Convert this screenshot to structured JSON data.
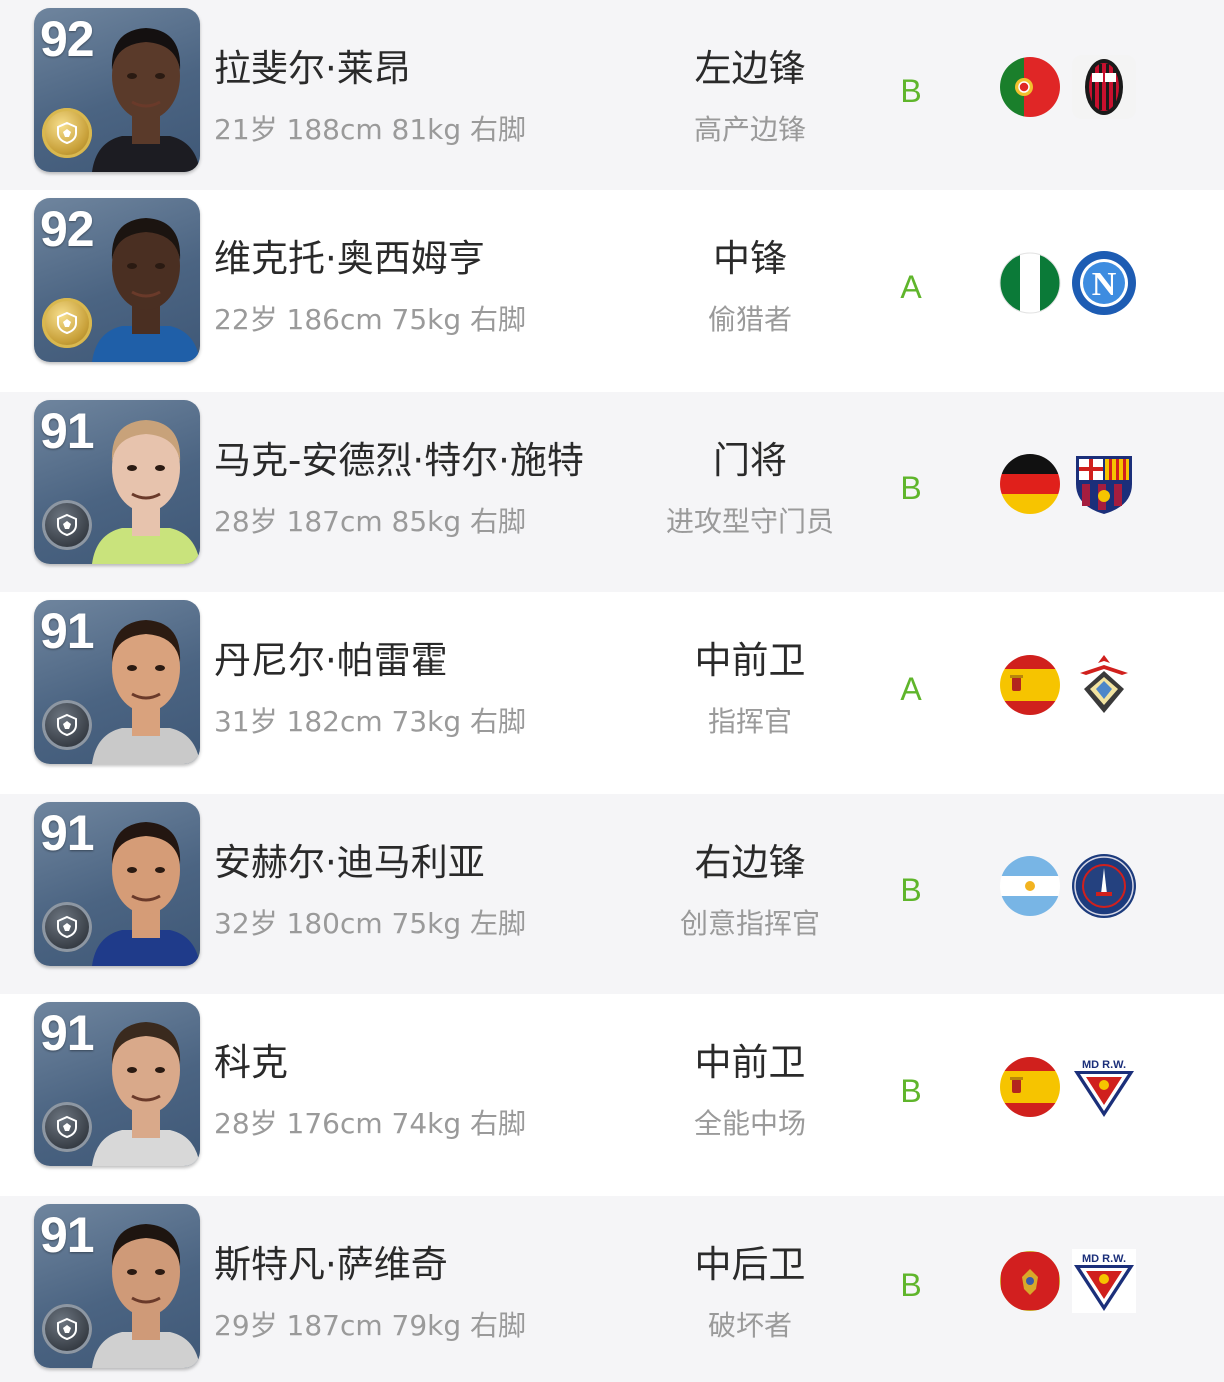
{
  "players": [
    {
      "rating": "92",
      "name": "拉斐尔·莱昂",
      "info": "21岁 188cm 81kg 右脚",
      "position": "左边锋",
      "style": "高产边锋",
      "grade": "B",
      "badge": "gold",
      "flag": "portugal-flag-icon",
      "club": "ac-milan-crest-icon",
      "skin": "#5a3a2a",
      "hair": "#141010",
      "shirt": "#1c1c22"
    },
    {
      "rating": "92",
      "name": "维克托·奥西姆亨",
      "info": "22岁 186cm 75kg 右脚",
      "position": "中锋",
      "style": "偷猎者",
      "grade": "A",
      "badge": "gold",
      "flag": "nigeria-flag-icon",
      "club": "napoli-crest-icon",
      "skin": "#4a2f22",
      "hair": "#1b1410",
      "shirt": "#1f5fa8"
    },
    {
      "rating": "91",
      "name": "马克-安德烈·特尔·施特",
      "info": "28岁 187cm 85kg 右脚",
      "position": "门将",
      "style": "进攻型守门员",
      "grade": "B",
      "badge": "dark",
      "flag": "germany-flag-icon",
      "club": "fc-barcelona-crest-icon",
      "skin": "#e7c3ad",
      "hair": "#c8a27a",
      "shirt": "#c9e37c"
    },
    {
      "rating": "91",
      "name": "丹尼尔·帕雷霍",
      "info": "31岁 182cm 73kg 右脚",
      "position": "中前卫",
      "style": "指挥官",
      "grade": "A",
      "badge": "dark",
      "flag": "spain-flag-icon",
      "club": "villarreal-crest-icon",
      "skin": "#d9a27d",
      "hair": "#2b1b12",
      "shirt": "#c9c9c9"
    },
    {
      "rating": "91",
      "name": "安赫尔·迪马利亚",
      "info": "32岁 180cm 75kg 左脚",
      "position": "右边锋",
      "style": "创意指挥官",
      "grade": "B",
      "badge": "dark",
      "flag": "argentina-flag-icon",
      "club": "psg-crest-icon",
      "skin": "#d59c77",
      "hair": "#231611",
      "shirt": "#1f3b8a"
    },
    {
      "rating": "91",
      "name": "科克",
      "info": "28岁 176cm 74kg 右脚",
      "position": "中前卫",
      "style": "全能中场",
      "grade": "B",
      "badge": "dark",
      "flag": "spain-flag-icon",
      "club": "md-rw-crest-icon",
      "skin": "#d9a98a",
      "hair": "#3a2a1e",
      "shirt": "#d8d8d8"
    },
    {
      "rating": "91",
      "name": "斯特凡·萨维奇",
      "info": "29岁 187cm 79kg 右脚",
      "position": "中后卫",
      "style": "破坏者",
      "grade": "B",
      "badge": "dark",
      "flag": "montenegro-flag-icon",
      "club": "md-rw-crest-icon",
      "skin": "#cf9a78",
      "hair": "#1e1510",
      "shirt": "#d0d0d0"
    }
  ]
}
